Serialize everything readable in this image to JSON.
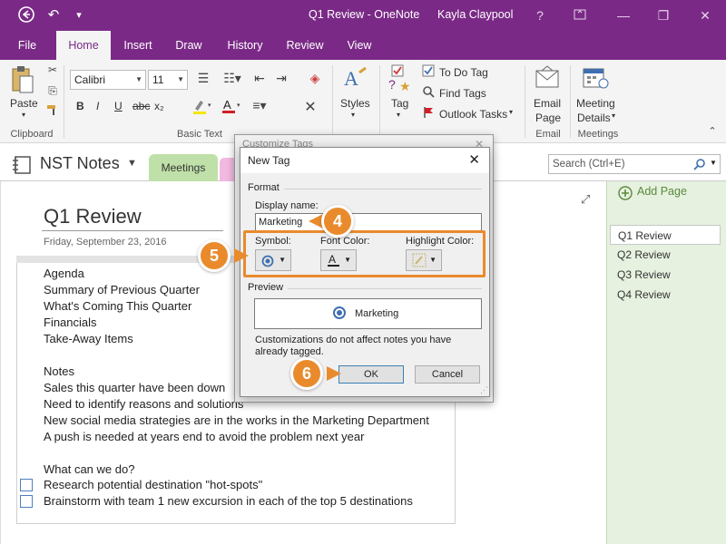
{
  "titlebar": {
    "title": "Q1 Review - OneNote",
    "user": "Kayla Claypool",
    "help": "?",
    "minimize": "—",
    "restore": "❐",
    "close": "✕"
  },
  "tabs": [
    "File",
    "Home",
    "Insert",
    "Draw",
    "History",
    "Review",
    "View"
  ],
  "ribbon": {
    "paste_label": "Paste",
    "clipboard_label": "Clipboard",
    "font_name": "Calibri",
    "font_size": "11",
    "basic_text_label": "Basic Text",
    "styles_label": "Styles",
    "styles_group_label": "Styles",
    "tag_label": "Tag",
    "todo_tag": "To Do Tag",
    "find_tags": "Find Tags",
    "outlook_tasks": "Outlook Tasks",
    "email_page_line1": "Email",
    "email_page_line2": "Page",
    "email_group": "Email",
    "meeting_details_line1": "Meeting",
    "meeting_details_line2": "Details",
    "meetings_group": "Meetings",
    "bold": "B",
    "italic": "I",
    "underline": "U",
    "strike": "abc",
    "subscript": "x₂"
  },
  "notebook": {
    "name": "NST Notes",
    "section": "Meetings",
    "search_placeholder": "Search (Ctrl+E)"
  },
  "page": {
    "title": "Q1 Review",
    "date": "Friday, September 23, 2016",
    "lines": [
      "Agenda",
      "Summary of Previous Quarter",
      "What's Coming This Quarter",
      "Financials",
      "Take-Away Items",
      "",
      "Notes",
      "Sales this quarter have been down",
      "Need to identify reasons and solutions",
      "New social media strategies are in the works in the Marketing Department",
      "A push is needed at years end to avoid the problem next year",
      "",
      "What can we do?"
    ],
    "todo_items": [
      "Research potential destination \"hot-spots\"",
      "Brainstorm with team 1 new excursion in each of the top 5 destinations"
    ]
  },
  "pages_pane": {
    "add_page": "Add Page",
    "items": [
      "Q1 Review",
      "Q2 Review",
      "Q3 Review",
      "Q4 Review"
    ]
  },
  "dialog_back": {
    "title": "Customize Tags"
  },
  "dialog": {
    "title": "New Tag",
    "format_label": "Format",
    "display_name_label": "Display name:",
    "display_name_value": "Marketing",
    "symbol_label": "Symbol:",
    "font_color_label": "Font Color:",
    "highlight_color_label": "Highlight Color:",
    "preview_label": "Preview",
    "preview_text": "Marketing",
    "note": "Customizations do not affect notes you have already tagged.",
    "ok": "OK",
    "cancel": "Cancel"
  },
  "callouts": [
    "4",
    "5",
    "6"
  ],
  "colors": {
    "accent": "#7a2a86",
    "callout": "#e98b2d",
    "section_green": "#bfe0a8",
    "pane_green": "#e6f1df",
    "tag_blue": "#3f6fb0"
  }
}
